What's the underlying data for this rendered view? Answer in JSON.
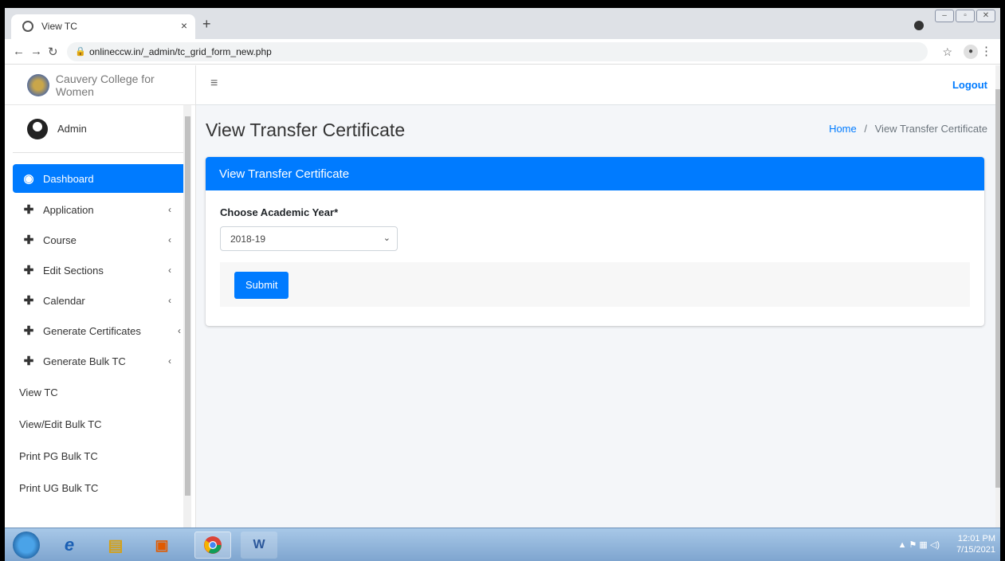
{
  "browser": {
    "tab_title": "View TC",
    "tab_close": "×",
    "new_tab": "+",
    "url": "onlineccw.in/_admin/tc_grid_form_new.php"
  },
  "sidebar": {
    "brand": "Cauvery College for Women",
    "user": "Admin",
    "items": [
      {
        "label": "Dashboard",
        "icon": "dashboard-icon",
        "active": true
      },
      {
        "label": "Application",
        "icon": "plus-icon",
        "chevron": "‹"
      },
      {
        "label": "Course",
        "icon": "plus-icon",
        "chevron": "‹"
      },
      {
        "label": "Edit Sections",
        "icon": "plus-icon",
        "chevron": "‹"
      },
      {
        "label": "Calendar",
        "icon": "plus-icon",
        "chevron": "‹"
      },
      {
        "label": "Generate Certificates",
        "icon": "plus-icon",
        "chevron": "‹"
      },
      {
        "label": "Generate Bulk TC",
        "icon": "plus-icon",
        "chevron": "‹"
      },
      {
        "label": "View TC"
      },
      {
        "label": "View/Edit Bulk TC"
      },
      {
        "label": "Print PG Bulk TC"
      },
      {
        "label": "Print UG Bulk TC"
      }
    ]
  },
  "topnav": {
    "menu_icon": "≡",
    "logout": "Logout"
  },
  "content": {
    "page_title": "View Transfer Certificate",
    "breadcrumb": {
      "home": "Home",
      "separator": "/",
      "current": "View Transfer Certificate"
    },
    "card": {
      "header": "View Transfer Certificate",
      "label": "Choose Academic Year*",
      "selected_year": "2018-19",
      "submit": "Submit"
    }
  },
  "taskbar": {
    "time": "12:01 PM",
    "date": "7/15/2021"
  },
  "colors": {
    "primary": "#007bff",
    "page_bg": "#f4f6f9"
  }
}
